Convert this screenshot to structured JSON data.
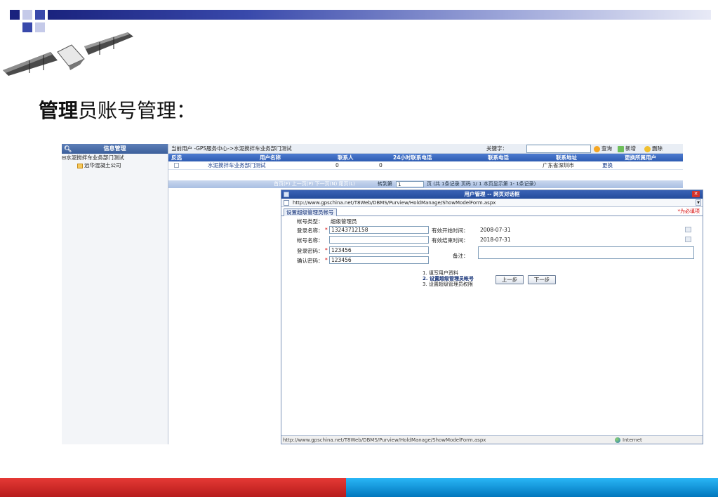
{
  "slide": {
    "title_bold": "管理",
    "title_rest": "员账号管理："
  },
  "left_panel": {
    "header": "信息管理",
    "tree": [
      "水泥搅拌车业务部门测试",
      "远华混凝土公司"
    ]
  },
  "breadcrumb": "当前用户  -GPS服务中心->水泥搅拌车业务部门测试",
  "toolbar": {
    "keyword_label": "关键字：",
    "query": "查询",
    "add": "新增",
    "delete": "删除"
  },
  "grid": {
    "columns": [
      "反选",
      "用户名称",
      "联系人",
      "24小时联系电话",
      "联系电话",
      "联系地址",
      "更换所属用户"
    ],
    "row": {
      "name": "水泥搅拌车业务部门测试",
      "contact": "0",
      "phone24": "0",
      "phone": "",
      "address": "广东省深圳市",
      "change": "更换"
    }
  },
  "pager": {
    "nav": "首页(F)  上一页(P)  下一页(N)  尾页(L)",
    "goto": "转到第",
    "page": "1",
    "info": "页  (共 1条记录  页码 1/ 1  本页显示第 1- 1条记录)"
  },
  "dialog": {
    "title": "用户管理 -- 网页对话框",
    "url": "http://www.gpschina.net/T8Web/DBMS/Purview/HoldManage/ShowModelForm.aspx",
    "tab": "设置超级管理员帐号",
    "required_note": "*为必填项",
    "account_type_label": "帐号类型：",
    "account_type_value": "超级管理员",
    "login_name_label": "登录名称：",
    "login_name_value": "13243712158",
    "account_name_label": "帐号名称：",
    "account_name_value": "",
    "login_pwd_label": "登录密码：",
    "login_pwd_value": "123456",
    "confirm_pwd_label": "确认密码：",
    "confirm_pwd_value": "123456",
    "start_label": "有效开始时间：",
    "start_value": "2008-07-31",
    "end_label": "有效结束时间：",
    "end_value": "2018-07-31",
    "remark_label": "备注：",
    "remark_value": "",
    "steps": [
      "1. 填写用户资料",
      "2. 设置超级管理员帐号",
      "3. 设置超级管理员权限"
    ],
    "prev_button": "上一步",
    "next_button": "下一步",
    "status_url": "http://www.gpschina.net/T8Web/DBMS/Purview/HoldManage/ShowModelForm.aspx",
    "zone": "Internet"
  },
  "colors": {
    "header_blue": "#2e5cb2",
    "required_red": "#d40000",
    "bottom_red": "#b71c1c",
    "bottom_blue": "#0277bd"
  }
}
